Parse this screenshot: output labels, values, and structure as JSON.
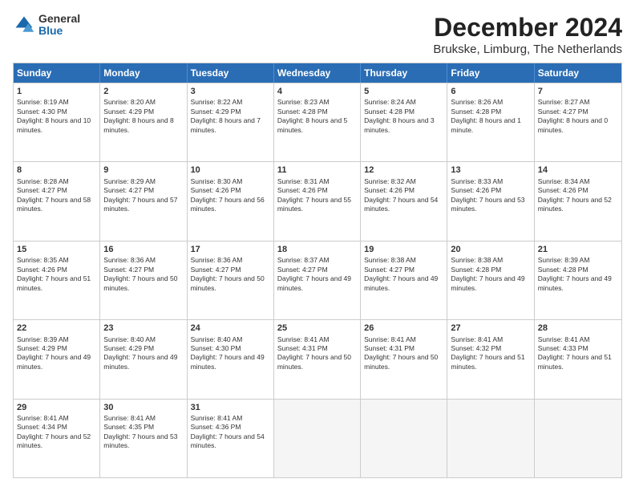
{
  "logo": {
    "general": "General",
    "blue": "Blue"
  },
  "title": "December 2024",
  "subtitle": "Brukske, Limburg, The Netherlands",
  "days": [
    "Sunday",
    "Monday",
    "Tuesday",
    "Wednesday",
    "Thursday",
    "Friday",
    "Saturday"
  ],
  "weeks": [
    [
      {
        "day": 1,
        "sunrise": "8:19 AM",
        "sunset": "4:30 PM",
        "daylight": "8 hours and 10 minutes."
      },
      {
        "day": 2,
        "sunrise": "8:20 AM",
        "sunset": "4:29 PM",
        "daylight": "8 hours and 8 minutes."
      },
      {
        "day": 3,
        "sunrise": "8:22 AM",
        "sunset": "4:29 PM",
        "daylight": "8 hours and 7 minutes."
      },
      {
        "day": 4,
        "sunrise": "8:23 AM",
        "sunset": "4:28 PM",
        "daylight": "8 hours and 5 minutes."
      },
      {
        "day": 5,
        "sunrise": "8:24 AM",
        "sunset": "4:28 PM",
        "daylight": "8 hours and 3 minutes."
      },
      {
        "day": 6,
        "sunrise": "8:26 AM",
        "sunset": "4:28 PM",
        "daylight": "8 hours and 1 minute."
      },
      {
        "day": 7,
        "sunrise": "8:27 AM",
        "sunset": "4:27 PM",
        "daylight": "8 hours and 0 minutes."
      }
    ],
    [
      {
        "day": 8,
        "sunrise": "8:28 AM",
        "sunset": "4:27 PM",
        "daylight": "7 hours and 58 minutes."
      },
      {
        "day": 9,
        "sunrise": "8:29 AM",
        "sunset": "4:27 PM",
        "daylight": "7 hours and 57 minutes."
      },
      {
        "day": 10,
        "sunrise": "8:30 AM",
        "sunset": "4:26 PM",
        "daylight": "7 hours and 56 minutes."
      },
      {
        "day": 11,
        "sunrise": "8:31 AM",
        "sunset": "4:26 PM",
        "daylight": "7 hours and 55 minutes."
      },
      {
        "day": 12,
        "sunrise": "8:32 AM",
        "sunset": "4:26 PM",
        "daylight": "7 hours and 54 minutes."
      },
      {
        "day": 13,
        "sunrise": "8:33 AM",
        "sunset": "4:26 PM",
        "daylight": "7 hours and 53 minutes."
      },
      {
        "day": 14,
        "sunrise": "8:34 AM",
        "sunset": "4:26 PM",
        "daylight": "7 hours and 52 minutes."
      }
    ],
    [
      {
        "day": 15,
        "sunrise": "8:35 AM",
        "sunset": "4:26 PM",
        "daylight": "7 hours and 51 minutes."
      },
      {
        "day": 16,
        "sunrise": "8:36 AM",
        "sunset": "4:27 PM",
        "daylight": "7 hours and 50 minutes."
      },
      {
        "day": 17,
        "sunrise": "8:36 AM",
        "sunset": "4:27 PM",
        "daylight": "7 hours and 50 minutes."
      },
      {
        "day": 18,
        "sunrise": "8:37 AM",
        "sunset": "4:27 PM",
        "daylight": "7 hours and 49 minutes."
      },
      {
        "day": 19,
        "sunrise": "8:38 AM",
        "sunset": "4:27 PM",
        "daylight": "7 hours and 49 minutes."
      },
      {
        "day": 20,
        "sunrise": "8:38 AM",
        "sunset": "4:28 PM",
        "daylight": "7 hours and 49 minutes."
      },
      {
        "day": 21,
        "sunrise": "8:39 AM",
        "sunset": "4:28 PM",
        "daylight": "7 hours and 49 minutes."
      }
    ],
    [
      {
        "day": 22,
        "sunrise": "8:39 AM",
        "sunset": "4:29 PM",
        "daylight": "7 hours and 49 minutes."
      },
      {
        "day": 23,
        "sunrise": "8:40 AM",
        "sunset": "4:29 PM",
        "daylight": "7 hours and 49 minutes."
      },
      {
        "day": 24,
        "sunrise": "8:40 AM",
        "sunset": "4:30 PM",
        "daylight": "7 hours and 49 minutes."
      },
      {
        "day": 25,
        "sunrise": "8:41 AM",
        "sunset": "4:31 PM",
        "daylight": "7 hours and 50 minutes."
      },
      {
        "day": 26,
        "sunrise": "8:41 AM",
        "sunset": "4:31 PM",
        "daylight": "7 hours and 50 minutes."
      },
      {
        "day": 27,
        "sunrise": "8:41 AM",
        "sunset": "4:32 PM",
        "daylight": "7 hours and 51 minutes."
      },
      {
        "day": 28,
        "sunrise": "8:41 AM",
        "sunset": "4:33 PM",
        "daylight": "7 hours and 51 minutes."
      }
    ],
    [
      {
        "day": 29,
        "sunrise": "8:41 AM",
        "sunset": "4:34 PM",
        "daylight": "7 hours and 52 minutes."
      },
      {
        "day": 30,
        "sunrise": "8:41 AM",
        "sunset": "4:35 PM",
        "daylight": "7 hours and 53 minutes."
      },
      {
        "day": 31,
        "sunrise": "8:41 AM",
        "sunset": "4:36 PM",
        "daylight": "7 hours and 54 minutes."
      },
      null,
      null,
      null,
      null
    ]
  ]
}
